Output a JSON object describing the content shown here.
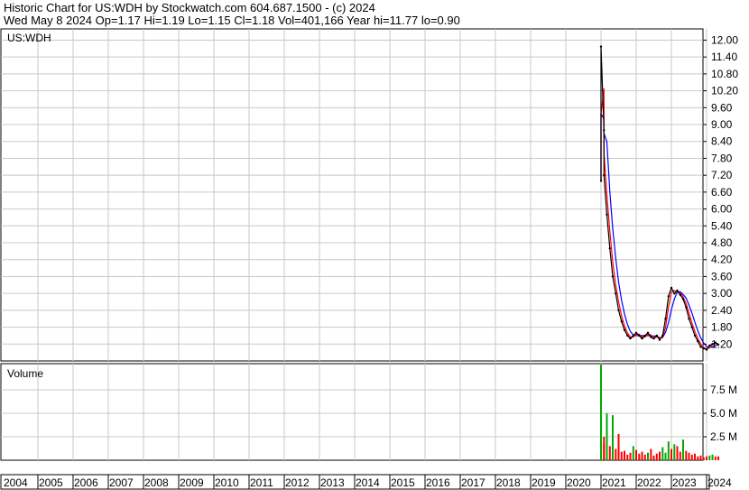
{
  "header": {
    "line1": "Historic Chart for US:WDH by Stockwatch.com 604.687.1500 - (c) 2024",
    "line2": "Wed May  8 2024   Op=1.17  Hi=1.19  Lo=1.15  Cl=1.18  Vol=401,166  Year hi=11.77  lo=0.90"
  },
  "colors": {
    "price": "#000000",
    "ma_short": "#ff0000",
    "ma_long": "#0000ff",
    "volume_up": "#00aa00",
    "volume_down": "#ff0000",
    "grid": "#c8c8c8"
  },
  "chart_data": [
    {
      "type": "line",
      "panel": "price",
      "title": "US:WDH",
      "ylim": [
        0.6,
        12.4
      ],
      "y_ticks": [
        "12.00",
        "11.40",
        "10.80",
        "10.20",
        "9.60",
        "9.00",
        "8.40",
        "7.80",
        "7.20",
        "6.60",
        "6.00",
        "5.40",
        "4.80",
        "4.20",
        "3.60",
        "3.00",
        "2.40",
        "1.80",
        "1.20"
      ],
      "x_years": [
        "2004",
        "2005",
        "2006",
        "2007",
        "2008",
        "2009",
        "2010",
        "2011",
        "2012",
        "2013",
        "2014",
        "2015",
        "2016",
        "2017",
        "2018",
        "2019",
        "2020",
        "2021",
        "2022",
        "2023",
        "2024"
      ],
      "x": [
        "2021-01",
        "2021-01",
        "2021-02",
        "2021-02",
        "2021-03",
        "2021-04",
        "2021-05",
        "2021-06",
        "2021-07",
        "2021-08",
        "2021-09",
        "2021-10",
        "2021-11",
        "2021-12",
        "2022-01",
        "2022-02",
        "2022-03",
        "2022-04",
        "2022-05",
        "2022-06",
        "2022-07",
        "2022-08",
        "2022-09",
        "2022-10",
        "2022-11",
        "2022-12",
        "2023-01",
        "2023-02",
        "2023-03",
        "2023-04",
        "2023-05",
        "2023-06",
        "2023-07",
        "2023-08",
        "2023-09",
        "2023-10",
        "2023-11",
        "2023-12",
        "2024-01",
        "2024-02",
        "2024-03",
        "2024-04",
        "2024-05"
      ],
      "series": [
        {
          "values": [
            7.0,
            11.77,
            8.8,
            7.2,
            5.8,
            4.6,
            3.6,
            3.0,
            2.4,
            2.0,
            1.7,
            1.5,
            1.4,
            1.5,
            1.6,
            1.5,
            1.4,
            1.5,
            1.6,
            1.45,
            1.4,
            1.5,
            1.35,
            1.5,
            2.1,
            2.9,
            3.2,
            3.0,
            3.1,
            2.95,
            2.8,
            2.5,
            2.1,
            1.8,
            1.5,
            1.3,
            1.1,
            1.05,
            1.0,
            1.15,
            1.2,
            1.25,
            1.18
          ]
        }
      ]
    },
    {
      "type": "bar",
      "panel": "volume",
      "title": "Volume",
      "ylim": [
        0,
        10.2
      ],
      "y_ticks": [
        "7.5 M",
        "5.0 M",
        "2.5 M"
      ],
      "x": [
        "2021-01",
        "2021-01",
        "2021-02",
        "2021-02",
        "2021-03",
        "2021-04",
        "2021-05",
        "2021-06",
        "2021-07",
        "2021-08",
        "2021-09",
        "2021-10",
        "2021-11",
        "2021-12",
        "2022-01",
        "2022-02",
        "2022-03",
        "2022-04",
        "2022-05",
        "2022-06",
        "2022-07",
        "2022-08",
        "2022-09",
        "2022-10",
        "2022-11",
        "2022-12",
        "2023-01",
        "2023-02",
        "2023-03",
        "2023-04",
        "2023-05",
        "2023-06",
        "2023-07",
        "2023-08",
        "2023-09",
        "2023-10",
        "2023-11",
        "2023-12",
        "2024-01",
        "2024-02",
        "2024-03",
        "2024-04",
        "2024-05"
      ],
      "values": [
        3.5,
        10.2,
        2.5,
        1.8,
        5.0,
        1.5,
        4.8,
        1.2,
        2.8,
        0.9,
        1.0,
        0.6,
        0.8,
        1.5,
        1.1,
        0.7,
        0.9,
        0.6,
        0.8,
        1.2,
        0.5,
        0.7,
        0.9,
        1.4,
        0.8,
        2.0,
        1.2,
        1.7,
        1.5,
        0.9,
        2.2,
        1.0,
        0.8,
        0.6,
        0.7,
        0.4,
        0.5,
        0.3,
        0.4,
        0.5,
        0.6,
        0.4,
        0.4
      ],
      "up": [
        false,
        true,
        false,
        false,
        true,
        false,
        true,
        false,
        false,
        false,
        false,
        false,
        false,
        true,
        false,
        false,
        false,
        false,
        true,
        false,
        false,
        false,
        false,
        true,
        true,
        true,
        false,
        true,
        false,
        false,
        true,
        false,
        false,
        false,
        false,
        false,
        false,
        false,
        false,
        true,
        true,
        false,
        false
      ]
    }
  ]
}
